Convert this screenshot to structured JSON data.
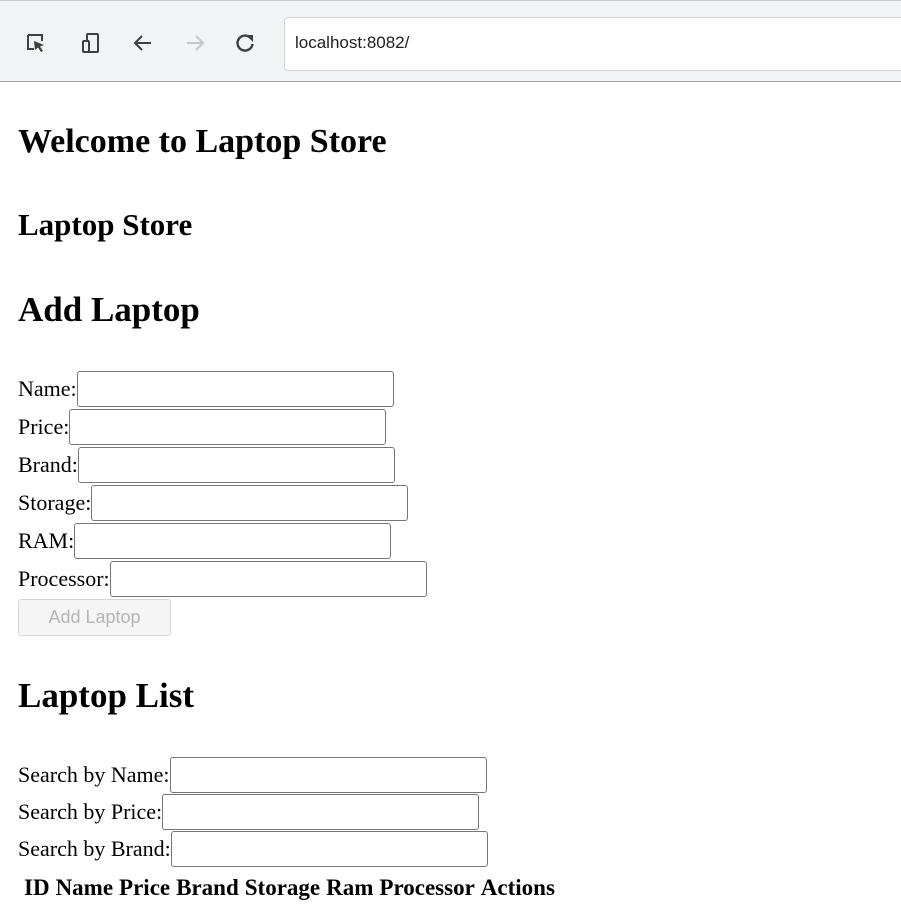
{
  "browser": {
    "url": "localhost:8082/",
    "icons": [
      "inspect-element-icon",
      "device-toggle-icon",
      "back-arrow-icon",
      "forward-arrow-icon",
      "reload-icon"
    ]
  },
  "page": {
    "welcome_heading": "Welcome to Laptop Store",
    "store_heading": "Laptop Store",
    "add_heading": "Add Laptop",
    "form": {
      "name_label": "Name:",
      "name_value": "",
      "price_label": "Price:",
      "price_value": "",
      "brand_label": "Brand:",
      "brand_value": "",
      "storage_label": "Storage:",
      "storage_value": "",
      "ram_label": "RAM:",
      "ram_value": "",
      "processor_label": "Processor:",
      "processor_value": "",
      "submit_label": "Add Laptop"
    },
    "list_heading": "Laptop List",
    "search": {
      "name_label": "Search by Name:",
      "name_value": "",
      "price_label": "Search by Price:",
      "price_value": "",
      "brand_label": "Search by Brand:",
      "brand_value": ""
    },
    "table": {
      "columns": [
        "ID",
        "Name",
        "Price",
        "Brand",
        "Storage",
        "Ram",
        "Processor",
        "Actions"
      ],
      "rows": []
    }
  }
}
